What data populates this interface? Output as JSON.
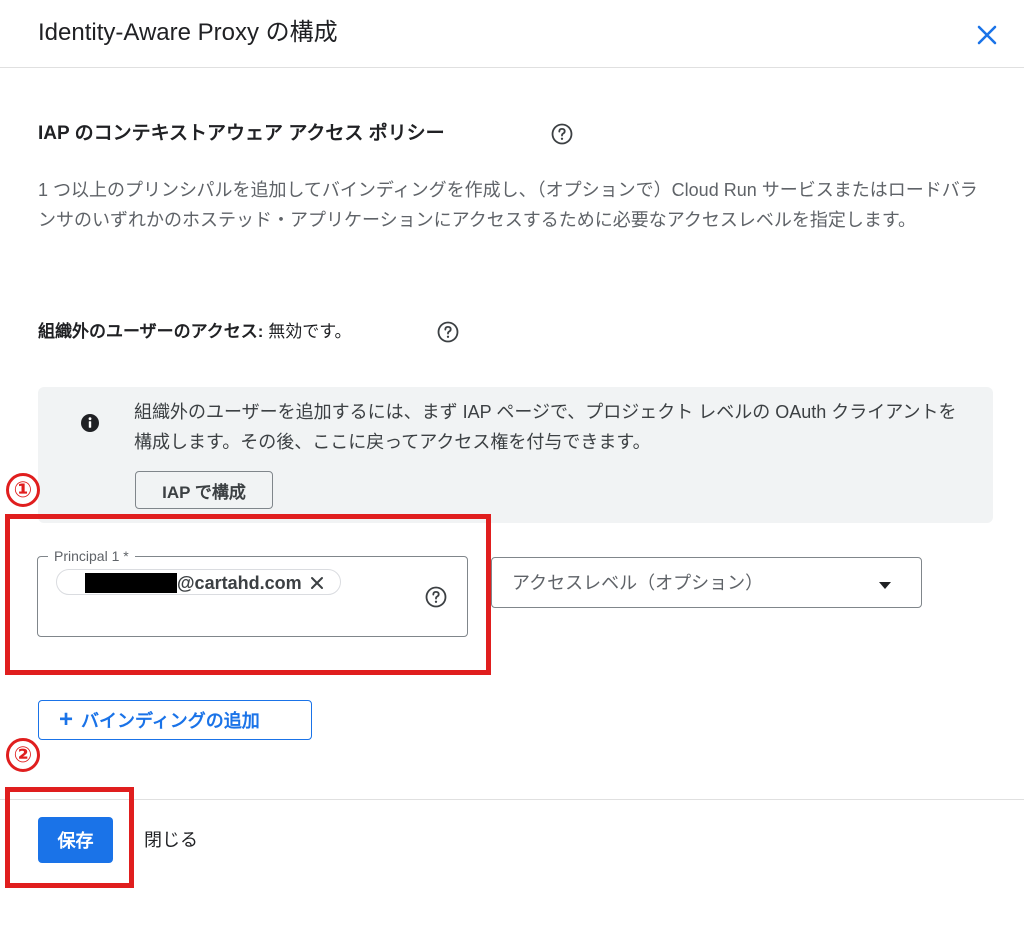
{
  "dialog": {
    "title": "Identity-Aware Proxy の構成"
  },
  "policy": {
    "section_title": "IAP のコンテキストアウェア アクセス ポリシー",
    "description": "1 つ以上のプリンシパルを追加してバインディングを作成し、（オプションで）Cloud Run サービスまたはロードバランサのいずれかのホステッド・アプリケーションにアクセスするために必要なアクセスレベルを指定します。",
    "external_access_label": "組織外のユーザーのアクセス:",
    "external_access_value": "無効です。"
  },
  "info": {
    "text": "組織外のユーザーを追加するには、まず IAP ページで、プロジェクト レベルの OAuth クライアントを構成します。その後、ここに戻ってアクセス権を付与できます。",
    "button_label": "IAP で構成"
  },
  "binding": {
    "principal_label": "Principal 1 *",
    "principal_chip": "@cartahd.com",
    "access_level_placeholder": "アクセスレベル（オプション）",
    "add_label": "バインディングの追加"
  },
  "annotations": {
    "marker_1": "①",
    "marker_2": "②",
    "color": "#e01e1e"
  },
  "footer": {
    "save_label": "保存",
    "close_label": "閉じる"
  },
  "colors": {
    "primary": "#1a73e8",
    "info_bg": "#f1f3f4",
    "text_secondary": "#5f6368"
  }
}
